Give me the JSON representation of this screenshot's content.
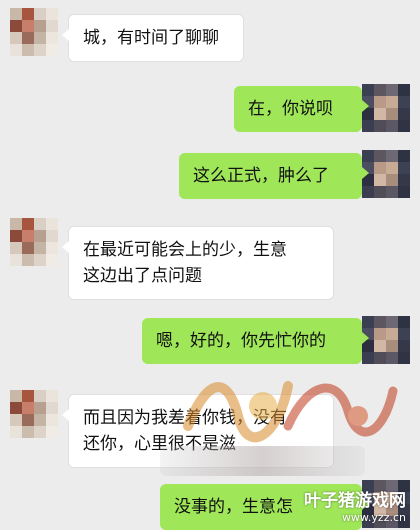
{
  "messages": [
    {
      "side": "in",
      "text": "城，有时间了聊聊"
    },
    {
      "side": "out",
      "text": "在，你说呗"
    },
    {
      "side": "out",
      "text": "这么正式，肿么了"
    },
    {
      "side": "in",
      "text": "在最近可能会上的少，生意\n这边出了点问题"
    },
    {
      "side": "out",
      "text": "嗯，好的，你先忙你的"
    },
    {
      "side": "in",
      "text": "而且因为我差着你钱，没有\n还你，心里很不是滋"
    },
    {
      "side": "out",
      "text": "没事的，生意怎"
    }
  ],
  "watermark": {
    "brand": "叶子猪游戏网",
    "url": "www.yzz.cn"
  },
  "colors": {
    "background": "#ececec",
    "incoming_bubble": "#ffffff",
    "outgoing_bubble": "#9fe658"
  }
}
